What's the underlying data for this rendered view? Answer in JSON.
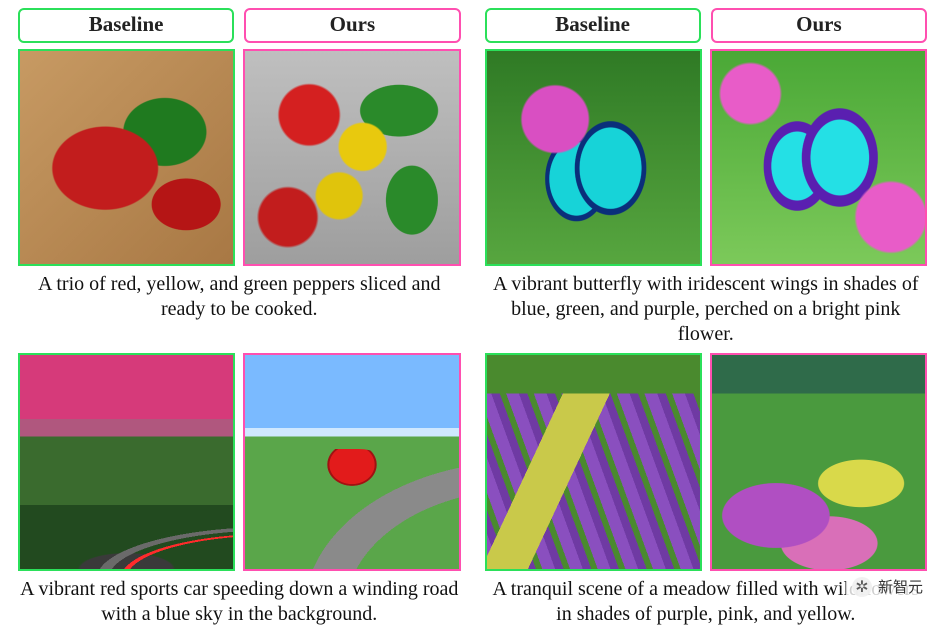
{
  "labels": {
    "baseline": "Baseline",
    "ours": "Ours"
  },
  "rows": [
    {
      "left": {
        "caption": "A trio of red, yellow, and green peppers sliced and ready to be cooked."
      },
      "right": {
        "caption": "A vibrant butterfly with iridescent wings in shades of blue, green, and purple, perched on a bright pink flower."
      }
    },
    {
      "left": {
        "caption": "A vibrant red sports car speeding down a winding road with a blue sky in the background."
      },
      "right": {
        "caption": "A tranquil scene of a meadow filled with wildflowers in shades of purple, pink, and yellow."
      }
    }
  ],
  "watermark": {
    "source": "新智元"
  }
}
